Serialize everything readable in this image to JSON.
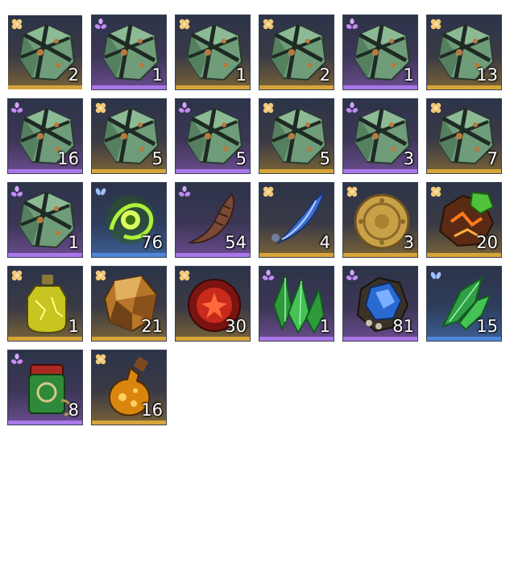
{
  "colors": {
    "gold": "#d6a53a",
    "purple": "#a877e8",
    "blue": "#4e86d8",
    "frame": "#3a4152"
  },
  "inventory": {
    "selected_index": 0,
    "items": [
      {
        "icon": "green-dice-chest-icon",
        "rarity": "gold",
        "count": "2"
      },
      {
        "icon": "green-dice-chest-icon",
        "rarity": "purple",
        "count": "1"
      },
      {
        "icon": "green-dice-chest-icon",
        "rarity": "gold",
        "count": "1"
      },
      {
        "icon": "green-dice-chest-icon",
        "rarity": "gold",
        "count": "2"
      },
      {
        "icon": "green-dice-chest-icon",
        "rarity": "purple",
        "count": "1"
      },
      {
        "icon": "green-dice-chest-icon",
        "rarity": "gold",
        "count": "13"
      },
      {
        "icon": "green-dice-chest-icon",
        "rarity": "purple",
        "count": "16"
      },
      {
        "icon": "green-dice-chest-icon",
        "rarity": "gold",
        "count": "5"
      },
      {
        "icon": "green-dice-chest-icon",
        "rarity": "purple",
        "count": "5"
      },
      {
        "icon": "green-dice-chest-icon",
        "rarity": "gold",
        "count": "5"
      },
      {
        "icon": "green-dice-chest-icon",
        "rarity": "purple",
        "count": "3"
      },
      {
        "icon": "green-dice-chest-icon",
        "rarity": "gold",
        "count": "7"
      },
      {
        "icon": "green-dice-chest-icon",
        "rarity": "purple",
        "count": "1"
      },
      {
        "icon": "green-energy-orb-icon",
        "rarity": "blue",
        "count": "76"
      },
      {
        "icon": "bone-claw-icon",
        "rarity": "purple",
        "count": "54"
      },
      {
        "icon": "blue-feather-icon",
        "rarity": "gold",
        "count": "4"
      },
      {
        "icon": "gold-coin-icon",
        "rarity": "gold",
        "count": "3"
      },
      {
        "icon": "molten-ore-icon",
        "rarity": "gold",
        "count": "20"
      },
      {
        "icon": "yellow-potion-icon",
        "rarity": "gold",
        "count": "1"
      },
      {
        "icon": "amber-stone-icon",
        "rarity": "gold",
        "count": "21"
      },
      {
        "icon": "red-orb-icon",
        "rarity": "gold",
        "count": "30"
      },
      {
        "icon": "green-crystal-cluster-icon",
        "rarity": "purple",
        "count": "1"
      },
      {
        "icon": "blue-gem-skull-icon",
        "rarity": "purple",
        "count": "81"
      },
      {
        "icon": "green-crystal-shard-icon",
        "rarity": "blue",
        "count": "15"
      },
      {
        "icon": "green-talisman-icon",
        "rarity": "purple",
        "count": "8"
      },
      {
        "icon": "amber-bottle-icon",
        "rarity": "gold",
        "count": "16"
      }
    ]
  }
}
